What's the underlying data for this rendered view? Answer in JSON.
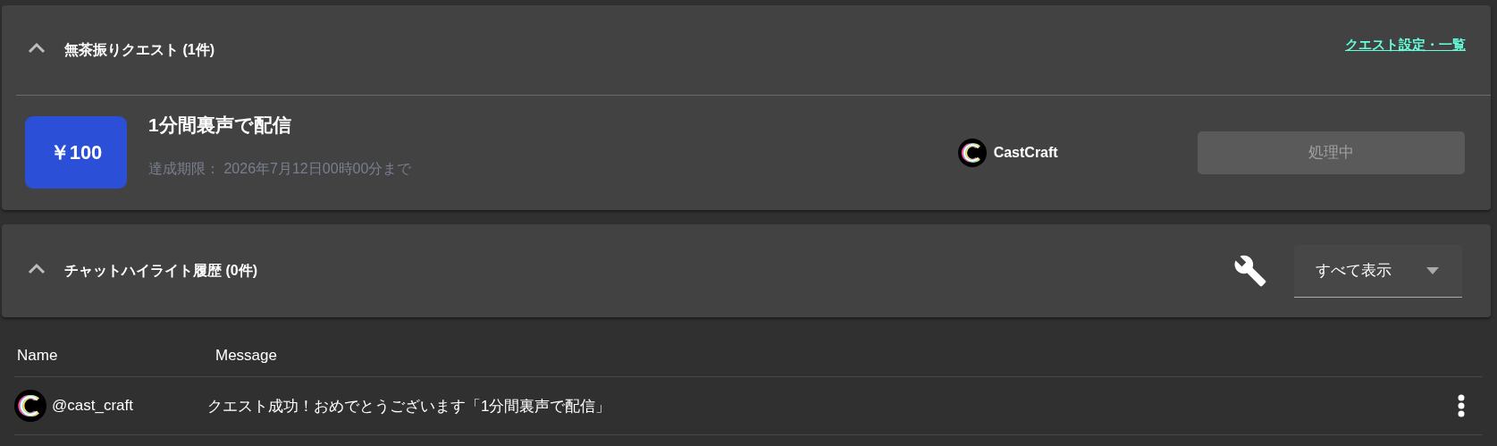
{
  "quest_panel": {
    "title": "無茶振りクエスト (1件)",
    "expanded": true,
    "link": "クエスト設定・一覧",
    "quests": [
      {
        "price": "￥100",
        "title": "1分間裏声で配信",
        "deadline": "達成期限： 2026年7月12日00時00分まで",
        "app_name": "CastCraft",
        "status_button": "処理中",
        "disabled": true
      }
    ]
  },
  "highlight_panel": {
    "title": "チャットハイライト履歴 (0件)",
    "expanded": true,
    "filter": "すべて表示"
  },
  "table": {
    "columns": [
      "Name",
      "Message"
    ],
    "rows": [
      {
        "name": "@cast_craft",
        "message": "クエスト成功！おめでとうございます「1分間裏声で配信」"
      }
    ]
  }
}
